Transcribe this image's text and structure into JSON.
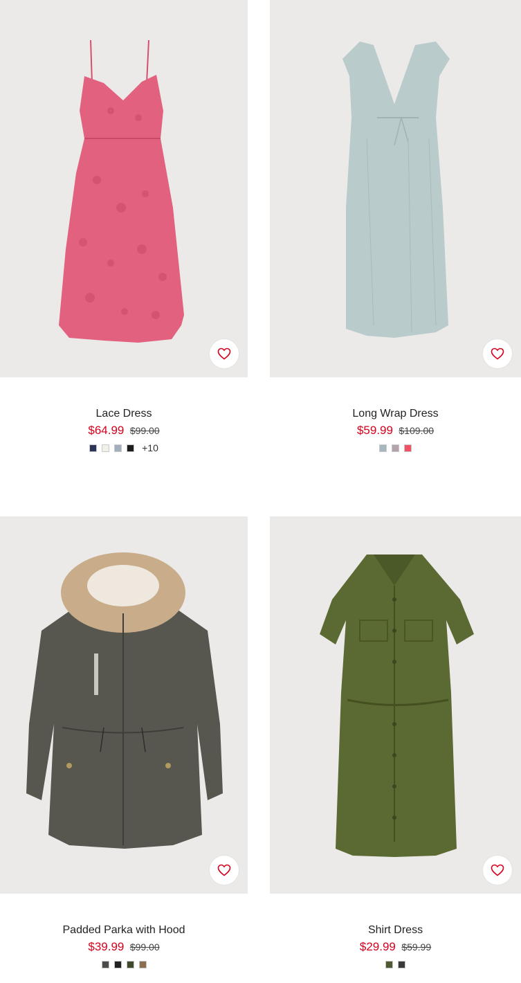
{
  "products": [
    {
      "name": "Lace Dress",
      "sale_price": "$64.99",
      "original_price": "$99.00",
      "image_icon": "lace-dress-image",
      "colors": [
        "#2d3556",
        "#f1f1ea",
        "#a3afbd",
        "#1d1d1d"
      ],
      "more_colors": "+10"
    },
    {
      "name": "Long Wrap Dress",
      "sale_price": "$59.99",
      "original_price": "$109.00",
      "image_icon": "wrap-dress-image",
      "colors": [
        "#a6b8bd",
        "#b3a3ad",
        "#ee5263"
      ],
      "more_colors": ""
    },
    {
      "name": "Padded Parka with Hood",
      "sale_price": "$39.99",
      "original_price": "$99.00",
      "image_icon": "parka-image",
      "colors": [
        "#4b4c48",
        "#222222",
        "#3f4a2c",
        "#8a7050"
      ],
      "more_colors": ""
    },
    {
      "name": "Shirt Dress",
      "sale_price": "$29.99",
      "original_price": "$59.99",
      "image_icon": "shirt-dress-image",
      "colors": [
        "#4e5a32",
        "#3a3a3a"
      ],
      "more_colors": ""
    }
  ],
  "accent_color": "#d6001c",
  "favorite_icon": "heart-icon"
}
